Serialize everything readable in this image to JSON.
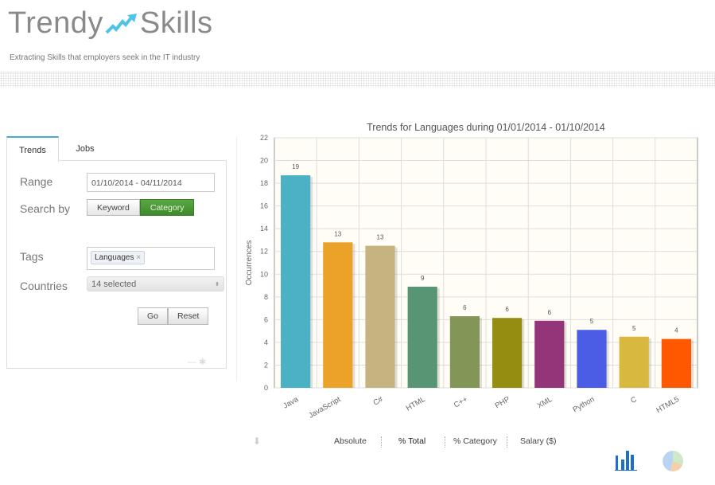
{
  "header": {
    "logo_left": "Trendy",
    "logo_right": "Skills",
    "tagline": "Extracting Skills that employers seek in the IT industry"
  },
  "panel": {
    "tabs": [
      {
        "label": "Trends",
        "active": true
      },
      {
        "label": "Jobs",
        "active": false
      }
    ],
    "range_label": "Range",
    "range_value": "01/10/2014 - 04/11/2014",
    "search_by_label": "Search by",
    "search_options": [
      "Keyword",
      "Category"
    ],
    "search_selected": "Category",
    "tags_label": "Tags",
    "tags": [
      "Languages"
    ],
    "countries_label": "Countries",
    "countries_value": "14 selected",
    "go_label": "Go",
    "reset_label": "Reset"
  },
  "chart_data": {
    "type": "bar",
    "title": "Trends for Languages during 01/01/2014 - 01/10/2014",
    "ylabel": "Occurrences",
    "xlabel": "",
    "ylim": [
      0,
      22
    ],
    "yticks": [
      0,
      2,
      4,
      6,
      8,
      10,
      12,
      14,
      16,
      18,
      20,
      22
    ],
    "grid": true,
    "categories": [
      "Java",
      "JavaScript",
      "C#",
      "HTML",
      "C++",
      "PHP",
      "XML",
      "Python",
      "C",
      "HTML5"
    ],
    "values": [
      18.7,
      12.8,
      12.5,
      8.9,
      6.3,
      6.15,
      5.9,
      5.1,
      4.5,
      4.3
    ],
    "data_labels": [
      "19",
      "13",
      "13",
      "9",
      "6",
      "6",
      "6",
      "5",
      "5",
      "4"
    ],
    "colors": [
      "#4bb2c5",
      "#eaa228",
      "#c5b47f",
      "#579575",
      "#839557",
      "#958c12",
      "#953579",
      "#4b5de4",
      "#d8b83f",
      "#ff5800"
    ],
    "background": "#fffdf6"
  },
  "controls": {
    "modes": [
      "Absolute",
      "% Total",
      "% Category",
      "Salary ($)"
    ],
    "selected": "% Total",
    "chart_types": [
      "bar-chart-icon",
      "pie-chart-icon"
    ]
  }
}
